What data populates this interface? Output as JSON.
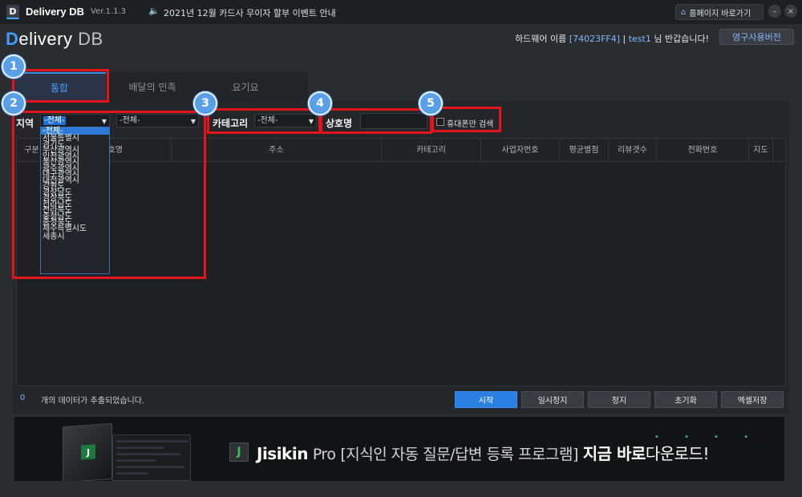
{
  "titlebar": {
    "app_icon": "D",
    "app_name": "Delivery DB",
    "version": "Ver.1.1.3",
    "notice_icon": "speaker-icon",
    "notice": "2021년 12월 카드사 무이자 할부 이벤트 안내",
    "home_label": "홈페이지 바로가기",
    "minimize": "–",
    "close": "×"
  },
  "header": {
    "logo_d": "D",
    "logo_rest": "elivery",
    "logo_db": "DB",
    "welcome_prefix": "하드웨어 이름",
    "hardware_id": "[74023FF4]",
    "separator": "|",
    "user": "test1",
    "welcome_suffix": "님 반갑습니다!",
    "perm_button": "영구사용버전"
  },
  "tabs": [
    {
      "label": "통합",
      "active": true
    },
    {
      "label": "배달의 민족",
      "active": false
    },
    {
      "label": "요기요",
      "active": false
    }
  ],
  "filters": {
    "region_label": "지역",
    "region_value": "-전체-",
    "subregion_value": "-전체-",
    "category_label": "카테고리",
    "category_value": "-전체-",
    "name_label": "상호명",
    "name_value": "",
    "closed_only_label": "휴대폰만 검색"
  },
  "region_options": [
    "-전체-",
    "서울특별시",
    "경기도",
    "부산광역시",
    "인천광역시",
    "울산광역시",
    "광주광역시",
    "대구광역시",
    "대전광역시",
    "강원도",
    "경상남도",
    "경상북도",
    "전라남도",
    "전라북도",
    "충청남도",
    "충청북도",
    "제주특별시도",
    "세종시"
  ],
  "table": {
    "columns": [
      "구분",
      "상호명",
      "주소",
      "카테고리",
      "사업자번호",
      "평균별점",
      "리뷰갯수",
      "전화번호",
      "지도"
    ]
  },
  "status": {
    "count": "0",
    "message": "개의 데이터가 추출되었습니다."
  },
  "actions": {
    "start": "시작",
    "pause": "일시정지",
    "stop": "정지",
    "reset": "초기화",
    "export": "엑셀저장"
  },
  "banner": {
    "icon_letter": "J",
    "brand": "Jisikin",
    "brand_pro": "Pro",
    "tagline": "[지식인 자동 질문/답변 등록 프로그램]",
    "cta_bold": "지금 바로",
    "cta_rest": "다운로드!"
  },
  "annotations": [
    "1",
    "2",
    "3",
    "4",
    "5"
  ],
  "colors": {
    "accent": "#2a80e0",
    "highlight": "#e3141c",
    "badge": "#5aa0e8"
  }
}
